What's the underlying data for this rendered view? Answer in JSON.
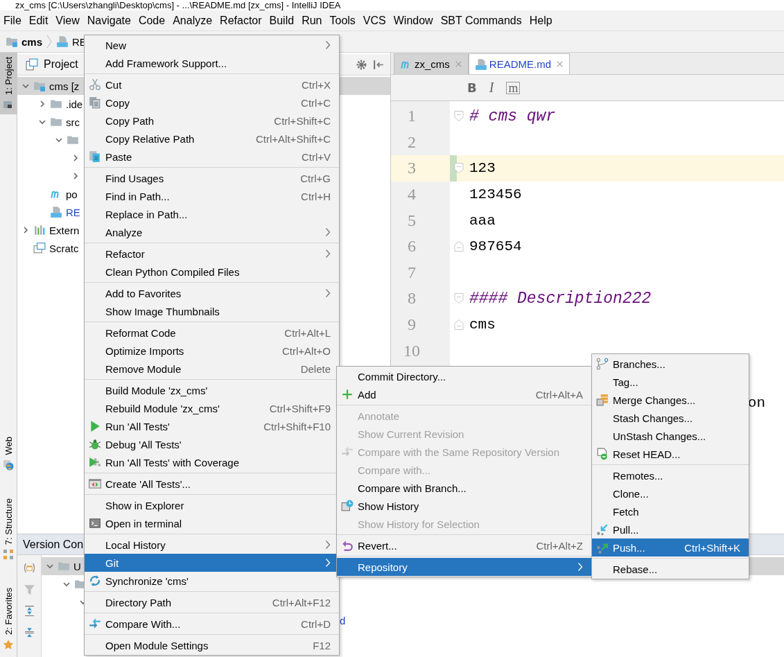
{
  "window": {
    "title": "zx_cms [C:\\Users\\zhangli\\Desktop\\cms] - ...\\README.md [zx_cms] - IntelliJ IDEA"
  },
  "menu_bar": [
    "File",
    "Edit",
    "View",
    "Navigate",
    "Code",
    "Analyze",
    "Refactor",
    "Build",
    "Run",
    "Tools",
    "VCS",
    "Window",
    "SBT Commands",
    "Help"
  ],
  "breadcrumb": [
    {
      "label": "cms",
      "kind": "module"
    },
    {
      "label": "RE",
      "kind": "markdown"
    }
  ],
  "tool_strip": {
    "top": [
      {
        "label": "1: Project",
        "kind": "project",
        "selected": true
      }
    ],
    "bottom": [
      {
        "label": "Web",
        "kind": "web",
        "selected": false
      },
      {
        "label": "7: Structure",
        "kind": "structure",
        "selected": false
      },
      {
        "label": "2: Favorites",
        "kind": "favorites",
        "selected": false
      }
    ]
  },
  "project_panel": {
    "title": "Project",
    "tree": [
      {
        "label": "cms [z",
        "kind": "module",
        "expanded": true,
        "selected": true,
        "children": [
          {
            "label": ".ide",
            "kind": "folder",
            "expanded": false,
            "selected": false
          },
          {
            "label": "src",
            "kind": "folder",
            "expanded": true,
            "selected": false,
            "children": [
              {
                "kind": "folder",
                "expanded": true,
                "selected": false,
                "children": [
                  {
                    "expanded": false,
                    "selected": false
                  },
                  {
                    "expanded": false,
                    "selected": false
                  }
                ]
              }
            ]
          },
          {
            "label": "po",
            "kind": "maven",
            "selected": false
          },
          {
            "label": "RE",
            "kind": "markdown",
            "modified": true,
            "selected": false
          }
        ]
      },
      {
        "label": "Extern",
        "kind": "libraries",
        "expanded": false,
        "selected": false
      },
      {
        "label": "Scratc",
        "kind": "scratches",
        "selected": false
      }
    ]
  },
  "editor": {
    "tabs": [
      {
        "label": "zx_cms",
        "kind": "maven",
        "modified": false,
        "selected": false
      },
      {
        "label": "README.md",
        "kind": "markdown",
        "modified": true,
        "selected": true
      }
    ],
    "format_buttons": [
      {
        "label": "B",
        "kind": "bold"
      },
      {
        "label": "I",
        "kind": "italic"
      },
      {
        "label": "m",
        "kind": "code"
      }
    ],
    "lines": [
      {
        "number": "1",
        "text": "# cms qwr",
        "kind": "heading",
        "fold_start": true,
        "fold_end": false,
        "selected": false,
        "changed": false
      },
      {
        "number": "2",
        "fold_start": false,
        "fold_end": false,
        "selected": false,
        "changed": false
      },
      {
        "number": "3",
        "text": "123",
        "kind": "plain",
        "fold_start": true,
        "fold_end": false,
        "selected": true,
        "changed": true
      },
      {
        "number": "4",
        "text": "123456",
        "kind": "plain",
        "fold_start": false,
        "fold_end": false,
        "selected": false,
        "changed": false
      },
      {
        "number": "5",
        "text": "aaa",
        "kind": "plain",
        "fold_start": false,
        "fold_end": false,
        "selected": false,
        "changed": false
      },
      {
        "number": "6",
        "text": "987654",
        "kind": "plain",
        "fold_start": false,
        "fold_end": true,
        "selected": false,
        "changed": false
      },
      {
        "number": "7",
        "fold_start": false,
        "fold_end": false,
        "selected": false,
        "changed": false
      },
      {
        "number": "8",
        "text": "#### Description222",
        "kind": "heading",
        "fold_start": true,
        "fold_end": false,
        "selected": false,
        "changed": false
      },
      {
        "number": "9",
        "text": "cms",
        "kind": "plain",
        "fold_start": false,
        "fold_end": true,
        "selected": false,
        "changed": false
      },
      {
        "number": "10",
        "fold_start": false,
        "fold_end": false,
        "selected": false,
        "changed": false
      }
    ],
    "covered_tail": "on"
  },
  "version_control_panel": {
    "title": "Version Con",
    "tree": [
      {
        "label": "U",
        "kind": "folder",
        "expanded": true,
        "selected": true,
        "children": [
          {
            "kind": "folder",
            "expanded": true,
            "selected": false,
            "children": [
              {
                "expanded": true,
                "selected": false
              }
            ]
          }
        ]
      }
    ],
    "covered_tail": "d"
  },
  "context_menu": {
    "groups": [
      [
        {
          "label": "New",
          "submenu": true,
          "selected": false
        },
        {
          "label": "Add Framework Support...",
          "selected": false
        }
      ],
      [
        {
          "label": "Cut",
          "shortcut": "Ctrl+X",
          "kind": "scissors",
          "selected": false
        },
        {
          "label": "Copy",
          "shortcut": "Ctrl+C",
          "kind": "copy",
          "selected": false
        },
        {
          "label": "Copy Path",
          "shortcut": "Ctrl+Shift+C",
          "selected": false
        },
        {
          "label": "Copy Relative Path",
          "shortcut": "Ctrl+Alt+Shift+C",
          "selected": false
        },
        {
          "label": "Paste",
          "shortcut": "Ctrl+V",
          "kind": "paste",
          "selected": false
        }
      ],
      [
        {
          "label": "Find Usages",
          "shortcut": "Ctrl+G",
          "selected": false
        },
        {
          "label": "Find in Path...",
          "shortcut": "Ctrl+H",
          "selected": false
        },
        {
          "label": "Replace in Path...",
          "selected": false
        },
        {
          "label": "Analyze",
          "submenu": true,
          "selected": false
        }
      ],
      [
        {
          "label": "Refactor",
          "submenu": true,
          "selected": false
        },
        {
          "label": "Clean Python Compiled Files",
          "selected": false
        }
      ],
      [
        {
          "label": "Add to Favorites",
          "submenu": true,
          "selected": false
        },
        {
          "label": "Show Image Thumbnails",
          "selected": false
        }
      ],
      [
        {
          "label": "Reformat Code",
          "shortcut": "Ctrl+Alt+L",
          "selected": false
        },
        {
          "label": "Optimize Imports",
          "shortcut": "Ctrl+Alt+O",
          "selected": false
        },
        {
          "label": "Remove Module",
          "shortcut": "Delete",
          "selected": false
        }
      ],
      [
        {
          "label": "Build Module 'zx_cms'",
          "selected": false
        },
        {
          "label": "Rebuild Module 'zx_cms'",
          "shortcut": "Ctrl+Shift+F9",
          "selected": false
        },
        {
          "label": "Run 'All Tests'",
          "shortcut": "Ctrl+Shift+F10",
          "kind": "play",
          "selected": false
        },
        {
          "label": "Debug 'All Tests'",
          "kind": "bug",
          "selected": false
        },
        {
          "label": "Run 'All Tests' with Coverage",
          "kind": "coverage",
          "selected": false
        }
      ],
      [
        {
          "label": "Create 'All Tests'...",
          "kind": "test-window",
          "selected": false
        }
      ],
      [
        {
          "label": "Show in Explorer",
          "selected": false
        },
        {
          "label": "Open in terminal",
          "kind": "terminal",
          "selected": false
        }
      ],
      [
        {
          "label": "Local History",
          "submenu": true,
          "selected": false
        },
        {
          "label": "Git",
          "submenu": true,
          "selected": true
        },
        {
          "label": "Synchronize 'cms'",
          "kind": "sync",
          "selected": false
        }
      ],
      [
        {
          "label": "Directory Path",
          "shortcut": "Ctrl+Alt+F12",
          "selected": false
        }
      ],
      [
        {
          "label": "Compare With...",
          "shortcut": "Ctrl+D",
          "kind": "compare",
          "selected": false
        }
      ],
      [
        {
          "label": "Open Module Settings",
          "shortcut": "F12",
          "selected": false
        }
      ]
    ]
  },
  "git_submenu": {
    "groups": [
      [
        {
          "label": "Commit Directory...",
          "disabled": false,
          "selected": false
        },
        {
          "label": "Add",
          "shortcut": "Ctrl+Alt+A",
          "kind": "plus",
          "disabled": false,
          "selected": false
        }
      ],
      [
        {
          "label": "Annotate",
          "disabled": true,
          "selected": false
        },
        {
          "label": "Show Current Revision",
          "disabled": true,
          "selected": false
        },
        {
          "label": "Compare with the Same Repository Version",
          "kind": "compare",
          "disabled": true,
          "selected": false
        },
        {
          "label": "Compare with...",
          "disabled": true,
          "selected": false
        },
        {
          "label": "Compare with Branch...",
          "disabled": false,
          "selected": false
        },
        {
          "label": "Show History",
          "kind": "history",
          "disabled": false,
          "selected": false
        },
        {
          "label": "Show History for Selection",
          "disabled": true,
          "selected": false
        }
      ],
      [
        {
          "label": "Revert...",
          "shortcut": "Ctrl+Alt+Z",
          "kind": "revert",
          "disabled": false,
          "selected": false
        }
      ],
      [
        {
          "label": "Repository",
          "submenu": true,
          "disabled": false,
          "selected": true
        }
      ]
    ]
  },
  "repository_submenu": {
    "groups": [
      [
        {
          "label": "Branches...",
          "kind": "branches",
          "selected": false
        },
        {
          "label": "Tag...",
          "selected": false
        },
        {
          "label": "Merge Changes...",
          "kind": "merge",
          "selected": false
        },
        {
          "label": "Stash Changes...",
          "selected": false
        },
        {
          "label": "UnStash Changes...",
          "selected": false
        },
        {
          "label": "Reset HEAD...",
          "kind": "reset",
          "selected": false
        }
      ],
      [
        {
          "label": "Remotes...",
          "selected": false
        },
        {
          "label": "Clone...",
          "selected": false
        },
        {
          "label": "Fetch",
          "selected": false
        },
        {
          "label": "Pull...",
          "kind": "pull",
          "selected": false
        },
        {
          "label": "Push...",
          "shortcut": "Ctrl+Shift+K",
          "kind": "push",
          "selected": true
        }
      ],
      [
        {
          "label": "Rebase...",
          "selected": false
        }
      ]
    ]
  }
}
